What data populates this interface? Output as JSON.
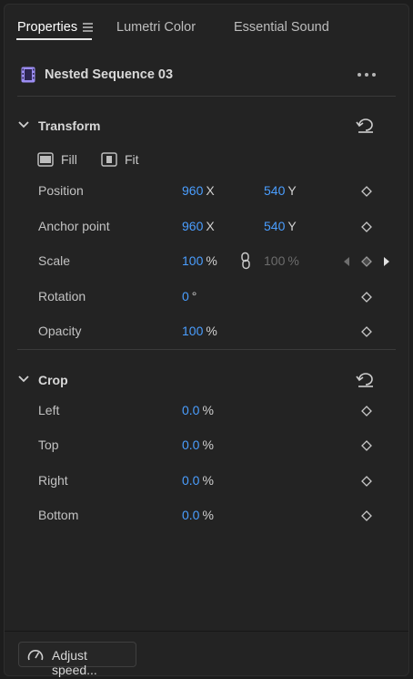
{
  "tabs": [
    {
      "label": "Properties",
      "active": true
    },
    {
      "label": "Lumetri Color",
      "active": false
    },
    {
      "label": "Essential Sound",
      "active": false
    }
  ],
  "clip": {
    "title": "Nested Sequence 03",
    "icon": "film-icon"
  },
  "transform": {
    "title": "Transform",
    "fill_label": "Fill",
    "fit_label": "Fit",
    "rows": {
      "position": {
        "label": "Position",
        "x": "960",
        "x_unit": "X",
        "y": "540",
        "y_unit": "Y"
      },
      "anchor": {
        "label": "Anchor point",
        "x": "960",
        "x_unit": "X",
        "y": "540",
        "y_unit": "Y"
      },
      "scale": {
        "label": "Scale",
        "value": "100",
        "unit": "%",
        "linked_value": "100",
        "linked_unit": "%"
      },
      "rotation": {
        "label": "Rotation",
        "value": "0",
        "unit": "°"
      },
      "opacity": {
        "label": "Opacity",
        "value": "100",
        "unit": "%"
      }
    }
  },
  "crop": {
    "title": "Crop",
    "rows": {
      "left": {
        "label": "Left",
        "value": "0.0",
        "unit": "%"
      },
      "top": {
        "label": "Top",
        "value": "0.0",
        "unit": "%"
      },
      "right": {
        "label": "Right",
        "value": "0.0",
        "unit": "%"
      },
      "bottom": {
        "label": "Bottom",
        "value": "0.0",
        "unit": "%"
      }
    }
  },
  "footer": {
    "speed_label": "Adjust speed..."
  },
  "colors": {
    "accent": "#4a9eff",
    "panel": "#232323",
    "clip_icon": "#9b8cf2"
  }
}
